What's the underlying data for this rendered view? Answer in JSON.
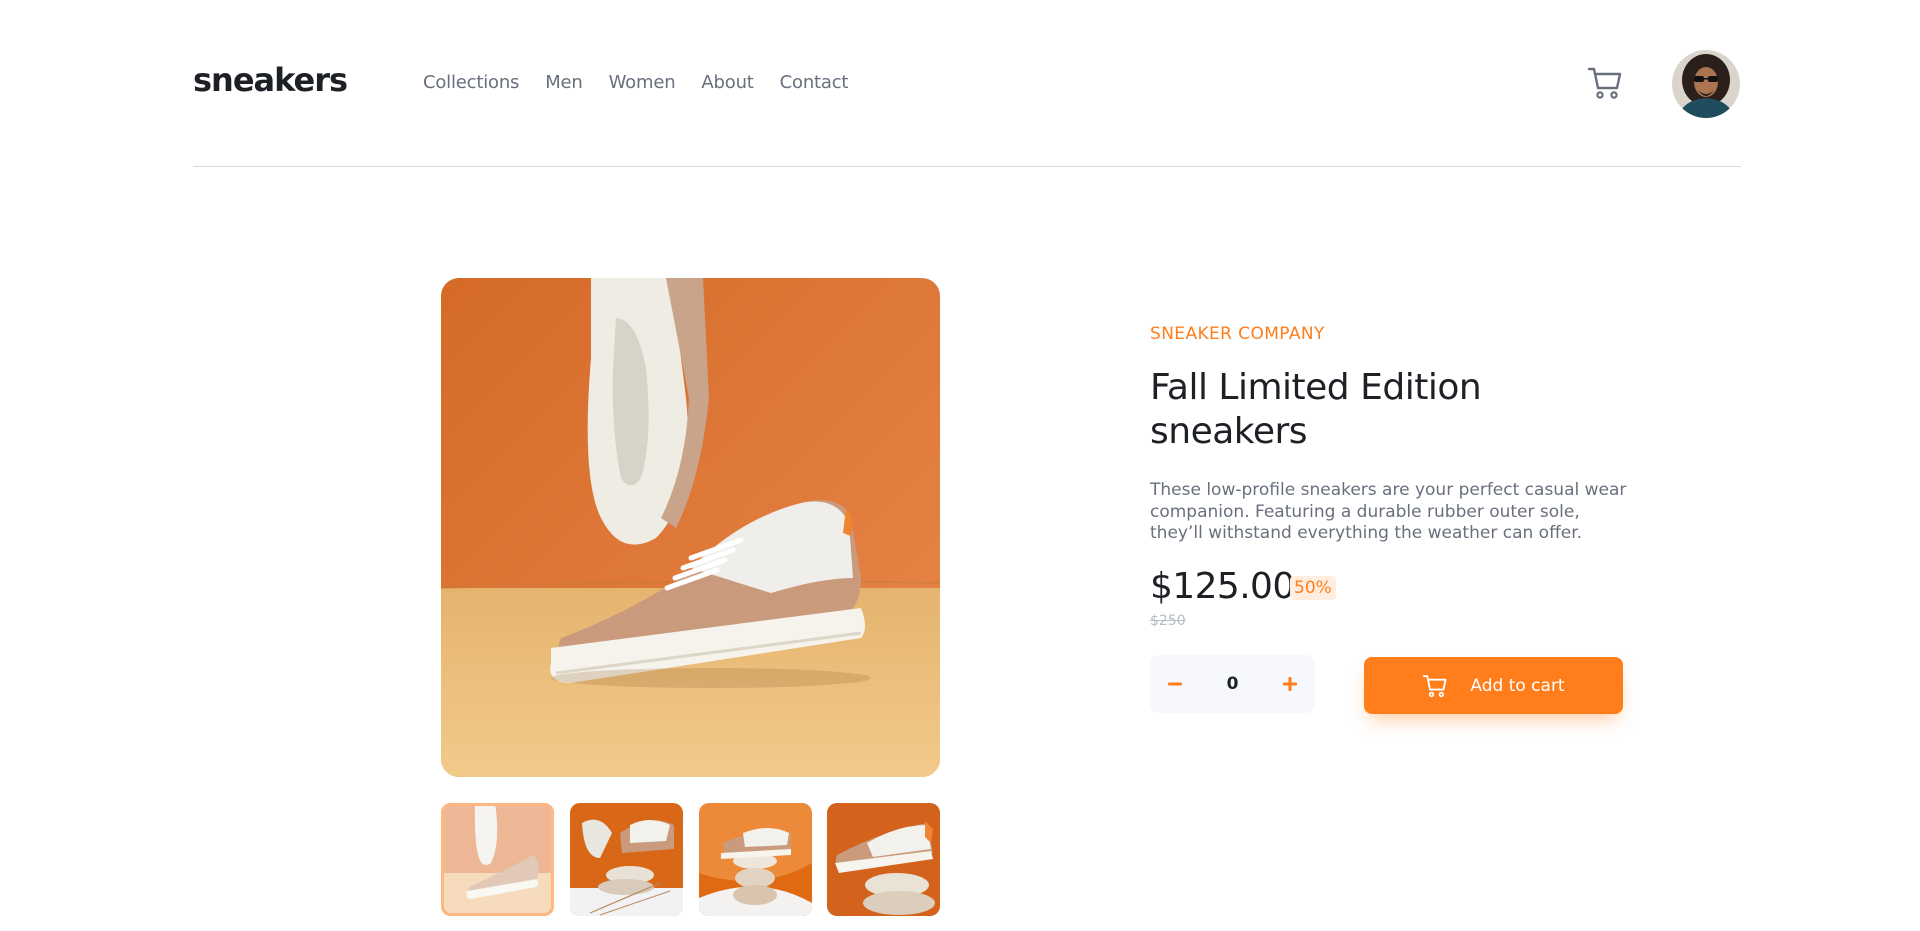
{
  "header": {
    "logo": "sneakers",
    "nav": [
      "Collections",
      "Men",
      "Women",
      "About",
      "Contact"
    ],
    "cart_icon": "cart-icon",
    "avatar_icon": "user-avatar"
  },
  "product": {
    "brand": "SNEAKER COMPANY",
    "title": "Fall Limited Edition sneakers",
    "description": "These low-profile sneakers are your perfect casual wear companion. Featuring a durable rubber outer sole, they’ll withstand everything the weather can offer.",
    "price": "$125.00",
    "discount": "50%",
    "old_price": "$250",
    "quantity": "0",
    "add_to_cart": "Add to cart"
  },
  "gallery": {
    "active_thumbnail": 1,
    "thumbnail_count": 4
  },
  "colors": {
    "accent": "#ff7e1b",
    "accent_pale": "#ffede0",
    "text_dark": "#1d2025",
    "text_grey": "#69707d",
    "text_light": "#b6bcc8",
    "qty_bg": "#f6f8fd"
  }
}
